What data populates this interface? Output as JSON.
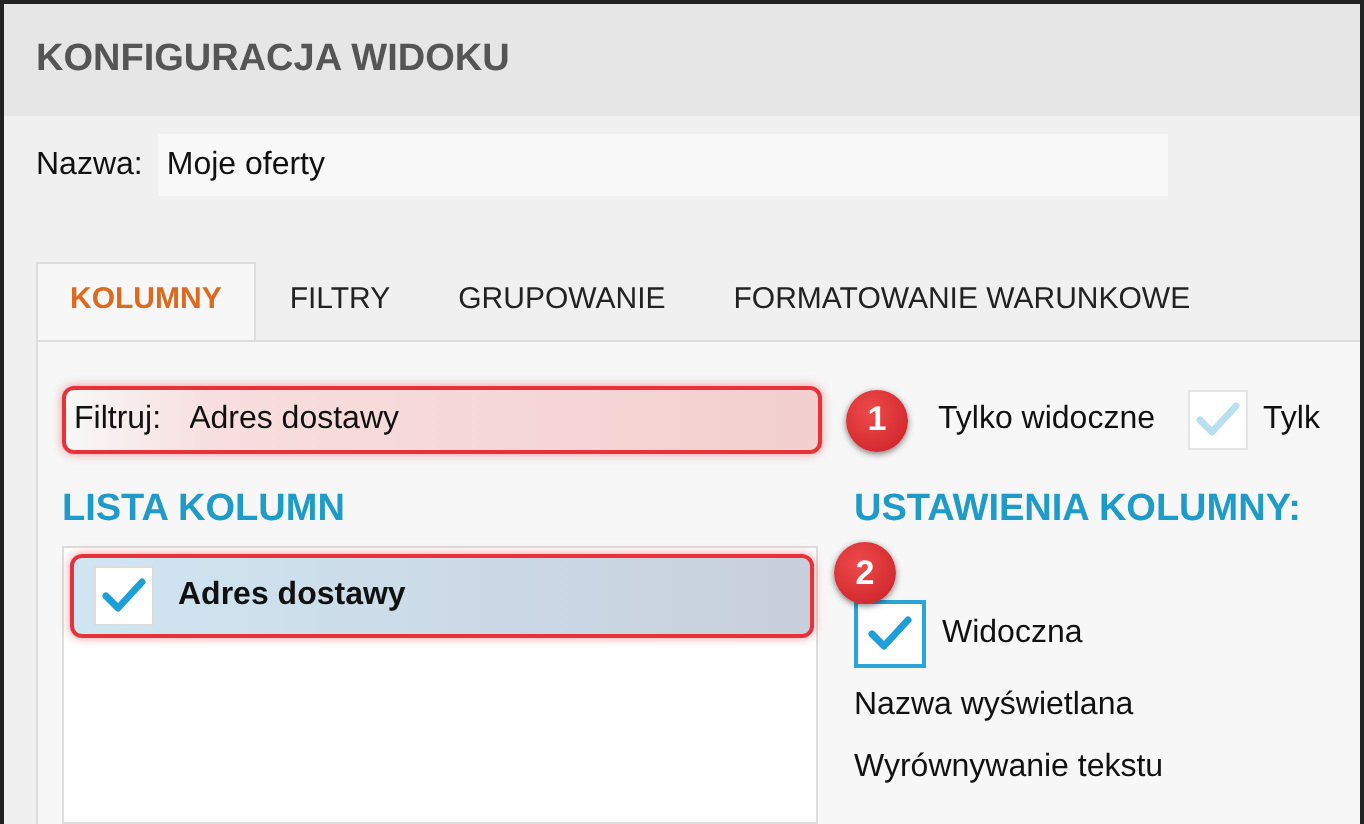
{
  "window": {
    "title": "KONFIGURACJA WIDOKU"
  },
  "name_field": {
    "label": "Nazwa:",
    "value": "Moje oferty"
  },
  "tabs": [
    {
      "label": "KOLUMNY",
      "selected": true
    },
    {
      "label": "FILTRY",
      "selected": false
    },
    {
      "label": "GRUPOWANIE",
      "selected": false
    },
    {
      "label": "FORMATOWANIE WARUNKOWE",
      "selected": false
    }
  ],
  "filter": {
    "label": "Filtruj:",
    "value": "Adres dostawy",
    "callout": "1"
  },
  "filter_options": [
    {
      "label": "Tylko widoczne"
    },
    {
      "label": "Tylk",
      "checked": true,
      "disabled": true
    }
  ],
  "column_list": {
    "heading": "LISTA KOLUMN",
    "items": [
      {
        "label": "Adres dostawy",
        "checked": true,
        "selected": true,
        "callout": "2"
      }
    ]
  },
  "column_settings": {
    "heading": "USTAWIENIA KOLUMNY:",
    "visible": {
      "label": "Widoczna",
      "checked": true
    },
    "fields": [
      "Nazwa wyświetlana",
      "Wyrównywanie tekstu"
    ]
  }
}
